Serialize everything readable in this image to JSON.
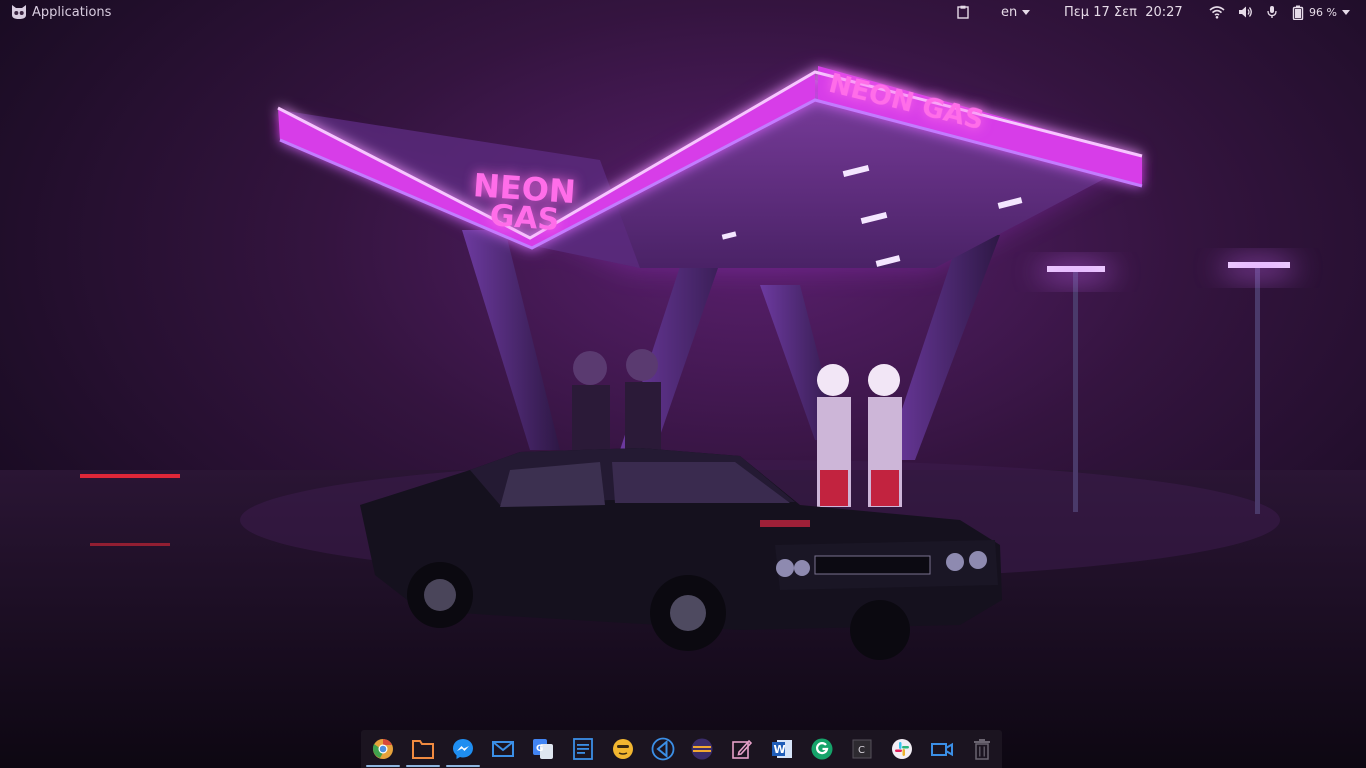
{
  "topbar": {
    "applications_label": "Applications",
    "language": "en",
    "datetime": "Πεμ 17 Σεπ  20:27",
    "battery_percent": "96 %"
  },
  "wallpaper": {
    "sign_left_line1": "NEON",
    "sign_left_line2": "GAS",
    "sign_right": "NEON GAS"
  },
  "dock": {
    "items": [
      {
        "name": "chrome",
        "running": true
      },
      {
        "name": "files",
        "running": true
      },
      {
        "name": "messenger",
        "running": true
      },
      {
        "name": "mail",
        "running": false
      },
      {
        "name": "translate",
        "running": false
      },
      {
        "name": "notes",
        "running": false
      },
      {
        "name": "emoji",
        "running": false
      },
      {
        "name": "vscode",
        "running": false
      },
      {
        "name": "eclipse",
        "running": false
      },
      {
        "name": "text-editor",
        "running": false
      },
      {
        "name": "word",
        "running": false
      },
      {
        "name": "grammarly",
        "running": false
      },
      {
        "name": "terminal",
        "running": false
      },
      {
        "name": "slack",
        "running": false
      },
      {
        "name": "video",
        "running": false
      },
      {
        "name": "trash",
        "running": false
      }
    ],
    "word_letter": "W",
    "terminal_letter": "C",
    "translate_letter": "G"
  }
}
